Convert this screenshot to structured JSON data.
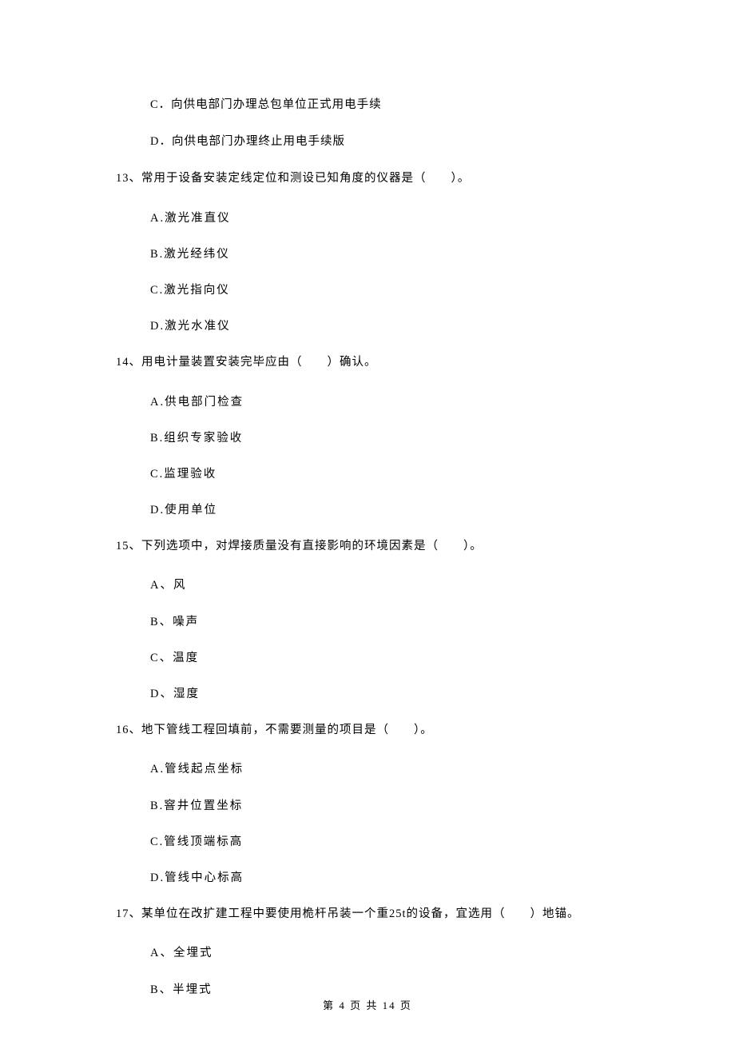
{
  "spillover_options": {
    "C": "C．向供电部门办理总包单位正式用电手续",
    "D": "D．向供电部门办理终止用电手续版"
  },
  "questions": [
    {
      "number": "13、",
      "text": "常用于设备安装定线定位和测设已知角度的仪器是（　　）。",
      "options": {
        "A": "A.激光准直仪",
        "B": "B.激光经纬仪",
        "C": "C.激光指向仪",
        "D": "D.激光水准仪"
      }
    },
    {
      "number": "14、",
      "text": "用电计量装置安装完毕应由（　　）确认。",
      "options": {
        "A": "A.供电部门检查",
        "B": "B.组织专家验收",
        "C": "C.监理验收",
        "D": "D.使用单位"
      }
    },
    {
      "number": "15、",
      "text": "下列选项中，对焊接质量没有直接影响的环境因素是（　　）。",
      "options": {
        "A": "A、风",
        "B": "B、噪声",
        "C": "C、温度",
        "D": "D、湿度"
      }
    },
    {
      "number": "16、",
      "text": "地下管线工程回填前，不需要测量的项目是（　　）。",
      "options": {
        "A": "A.管线起点坐标",
        "B": "B.窨井位置坐标",
        "C": "C.管线顶端标高",
        "D": "D.管线中心标高"
      }
    },
    {
      "number": "17、",
      "text": "某单位在改扩建工程中要使用桅杆吊装一个重25t的设备，宜选用（　　）地锚。",
      "options": {
        "A": "A、全埋式",
        "B": "B、半埋式"
      }
    }
  ],
  "footer": "第 4 页 共 14 页"
}
